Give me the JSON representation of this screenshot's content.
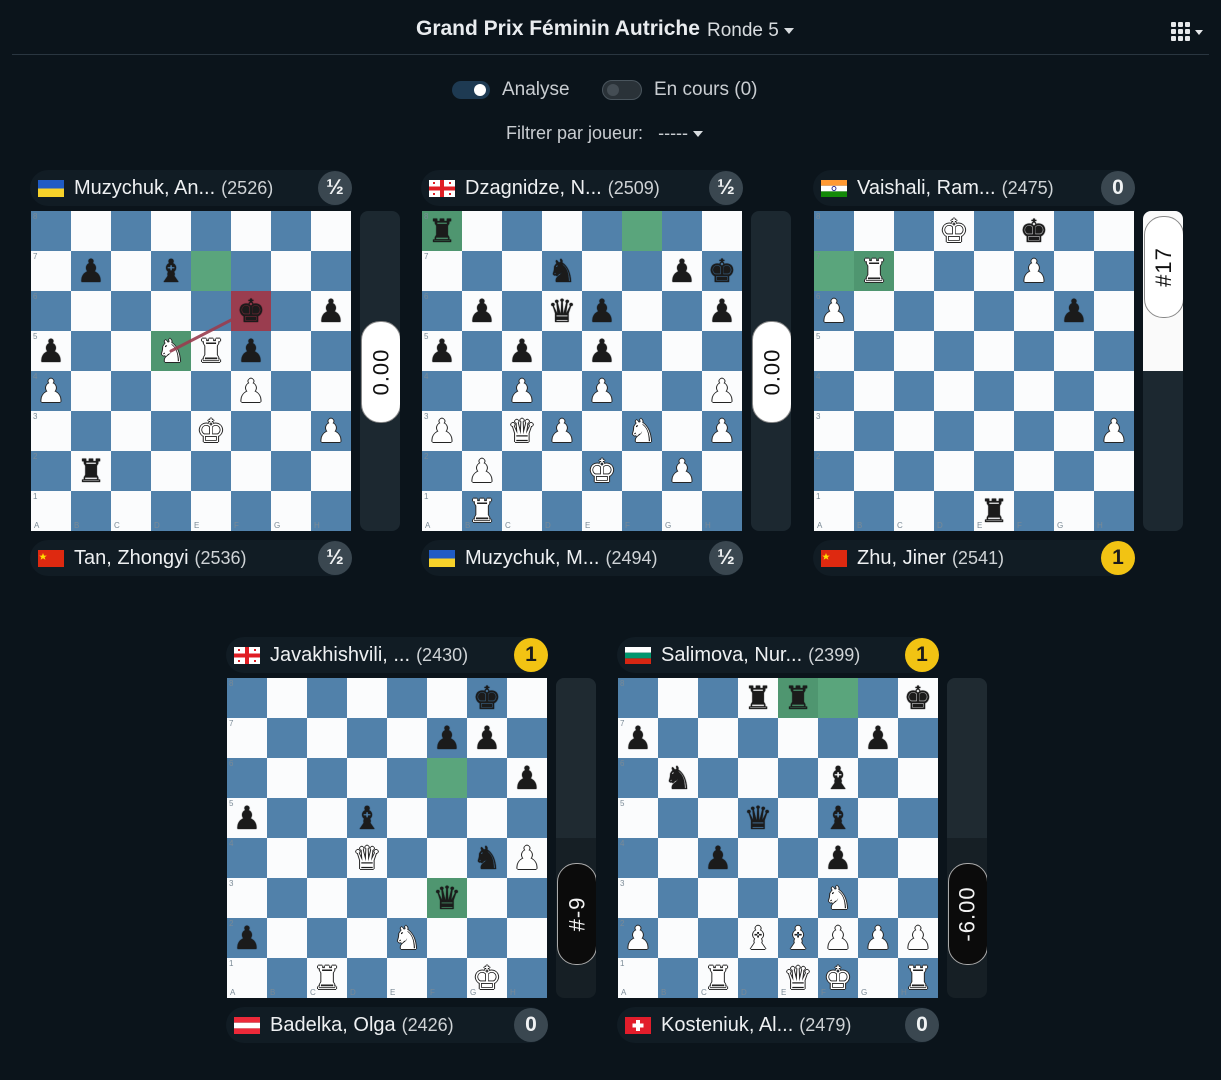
{
  "header": {
    "title": "Grand Prix Féminin Autriche",
    "round": "Ronde 5"
  },
  "toggles": [
    {
      "label": "Analyse",
      "on": true
    },
    {
      "label": "En cours (0)",
      "on": false
    }
  ],
  "filter": {
    "label": "Filtrer par joueur:",
    "value": "-----"
  },
  "colors": {
    "background": "#0b141b",
    "light_square": "#fbfcfd",
    "dark_square": "#5181aa",
    "highlight": "#5aa57c",
    "check": "#9a3d4f",
    "win_badge": "#f2c313"
  },
  "games": [
    {
      "top": {
        "flag": "ukraine",
        "name": "Muzychuk, An...",
        "rating": "(2526)",
        "score": "½"
      },
      "bottom": {
        "flag": "china",
        "name": "Tan, Zhongyi",
        "rating": "(2536)",
        "score": "½"
      },
      "eval": {
        "text": "0.00",
        "white_fraction": 0.5,
        "dark": false
      },
      "highlights": [
        "e7",
        "d5"
      ],
      "check": "f6",
      "arrow": [
        "d5",
        "f6"
      ],
      "pieces": {
        "b7": "bp",
        "d7": "bb",
        "f6": "bk",
        "h6": "bp",
        "a5": "bp",
        "d5": "wn",
        "e5": "wr",
        "f5": "bp",
        "a4": "wp",
        "f4": "wp",
        "e3": "wk",
        "h3": "wp",
        "b2": "br"
      }
    },
    {
      "top": {
        "flag": "georgia",
        "name": "Dzagnidze, N...",
        "rating": "(2509)",
        "score": "½"
      },
      "bottom": {
        "flag": "ukraine",
        "name": "Muzychuk, M...",
        "rating": "(2494)",
        "score": "½"
      },
      "eval": {
        "text": "0.00",
        "white_fraction": 0.5,
        "dark": false
      },
      "highlights": [
        "a8",
        "f8"
      ],
      "check": null,
      "arrow": null,
      "pieces": {
        "a8": "br",
        "d7": "bn",
        "g7": "bp",
        "h7": "bk",
        "b6": "bp",
        "d6": "bq",
        "e6": "bp",
        "h6": "bp",
        "a5": "bp",
        "c5": "bp",
        "e5": "bp",
        "c4": "wp",
        "e4": "wp",
        "h4": "wp",
        "a3": "wp",
        "c3": "wq",
        "d3": "wp",
        "f3": "wn",
        "h3": "wp",
        "b2": "wp",
        "e2": "wk",
        "g2": "wp",
        "b1": "wr"
      }
    },
    {
      "top": {
        "flag": "india",
        "name": "Vaishali, Ram...",
        "rating": "(2475)",
        "score": "0"
      },
      "bottom": {
        "flag": "china",
        "name": "Zhu, Jiner",
        "rating": "(2541)",
        "score": "1"
      },
      "eval": {
        "text": "#17",
        "white_fraction": 0.5,
        "dark": false
      },
      "highlights": [
        "a7",
        "b7"
      ],
      "check": null,
      "arrow": null,
      "pieces": {
        "d8": "wk",
        "f8": "bk",
        "b7": "wr",
        "f7": "wp",
        "a6": "wp",
        "g6": "bp",
        "h3": "wp",
        "e1": "br"
      }
    },
    {
      "top": {
        "flag": "georgia",
        "name": "Javakhishvili, ...",
        "rating": "(2430)",
        "score": "1"
      },
      "bottom": {
        "flag": "austria",
        "name": "Badelka, Olga",
        "rating": "(2426)",
        "score": "0"
      },
      "eval": {
        "text": "#-9",
        "white_fraction": 0.5,
        "dark": true
      },
      "highlights": [
        "f6",
        "f3"
      ],
      "check": null,
      "arrow": null,
      "pieces": {
        "g8": "bk",
        "f7": "bp",
        "g7": "bp",
        "h6": "bp",
        "a5": "bp",
        "d5": "bb",
        "d4": "wq",
        "g4": "bn",
        "h4": "wp",
        "f3": "bq",
        "a2": "bp",
        "e2": "wn",
        "c1": "wr",
        "g1": "wk"
      }
    },
    {
      "top": {
        "flag": "bulgaria",
        "name": "Salimova, Nur...",
        "rating": "(2399)",
        "score": "1"
      },
      "bottom": {
        "flag": "switzerland",
        "name": "Kosteniuk, Al...",
        "rating": "(2479)",
        "score": "0"
      },
      "eval": {
        "text": "-6.00",
        "white_fraction": 0.5,
        "dark": true
      },
      "highlights": [
        "e8",
        "f8"
      ],
      "check": null,
      "arrow": null,
      "pieces": {
        "d8": "br",
        "e8": "br",
        "h8": "bk",
        "a7": "bp",
        "g7": "bp",
        "b6": "bn",
        "f6": "bb",
        "d5": "bq",
        "f5": "bb",
        "c4": "bp",
        "f4": "bp",
        "f3": "wn",
        "a2": "wp",
        "d2": "wb",
        "e2": "wb",
        "f2": "wp",
        "g2": "wp",
        "h2": "wp",
        "c1": "wr",
        "e1": "wq",
        "f1": "wk",
        "h1": "wr"
      }
    }
  ]
}
